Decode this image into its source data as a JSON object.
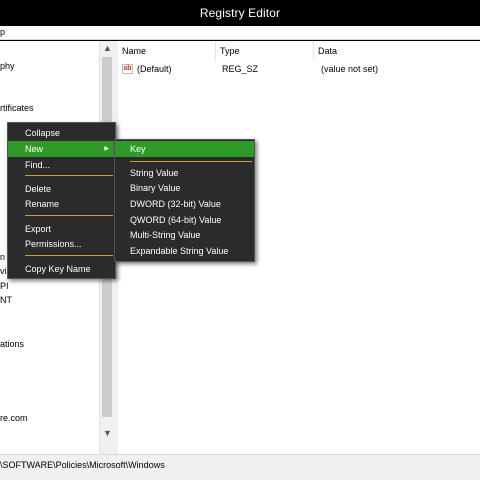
{
  "window": {
    "title": "Registry Editor"
  },
  "menubar": {
    "fragment": "p"
  },
  "tree": {
    "fragments": [
      {
        "text": "phy"
      },
      {
        "text": "rtificates"
      },
      {
        "text": "n"
      },
      {
        "text": "vi"
      },
      {
        "text": "PI"
      },
      {
        "text": "NT"
      },
      {
        "text": "ations"
      },
      {
        "text": "re.com"
      }
    ]
  },
  "list": {
    "columns": {
      "name": "Name",
      "type": "Type",
      "data": "Data"
    },
    "rows": [
      {
        "icon": "ab",
        "name": "(Default)",
        "type": "REG_SZ",
        "data": "(value not set)"
      }
    ]
  },
  "status": {
    "path": "\\SOFTWARE\\Policies\\Microsoft\\Windows"
  },
  "context_menu": {
    "collapse": "Collapse",
    "new": "New",
    "find": "Find...",
    "delete": "Delete",
    "rename": "Rename",
    "export": "Export",
    "permissions": "Permissions...",
    "copy_key_name": "Copy Key Name"
  },
  "submenu": {
    "key": "Key",
    "string_value": "String Value",
    "binary_value": "Binary Value",
    "dword": "DWORD (32-bit) Value",
    "qword": "QWORD (64-bit) Value",
    "multi_string": "Multi-String Value",
    "expandable_string": "Expandable String Value"
  },
  "colors": {
    "highlight": "#2e9b28",
    "menu_bg": "#2b2b2b",
    "separator": "#c9a13b"
  }
}
